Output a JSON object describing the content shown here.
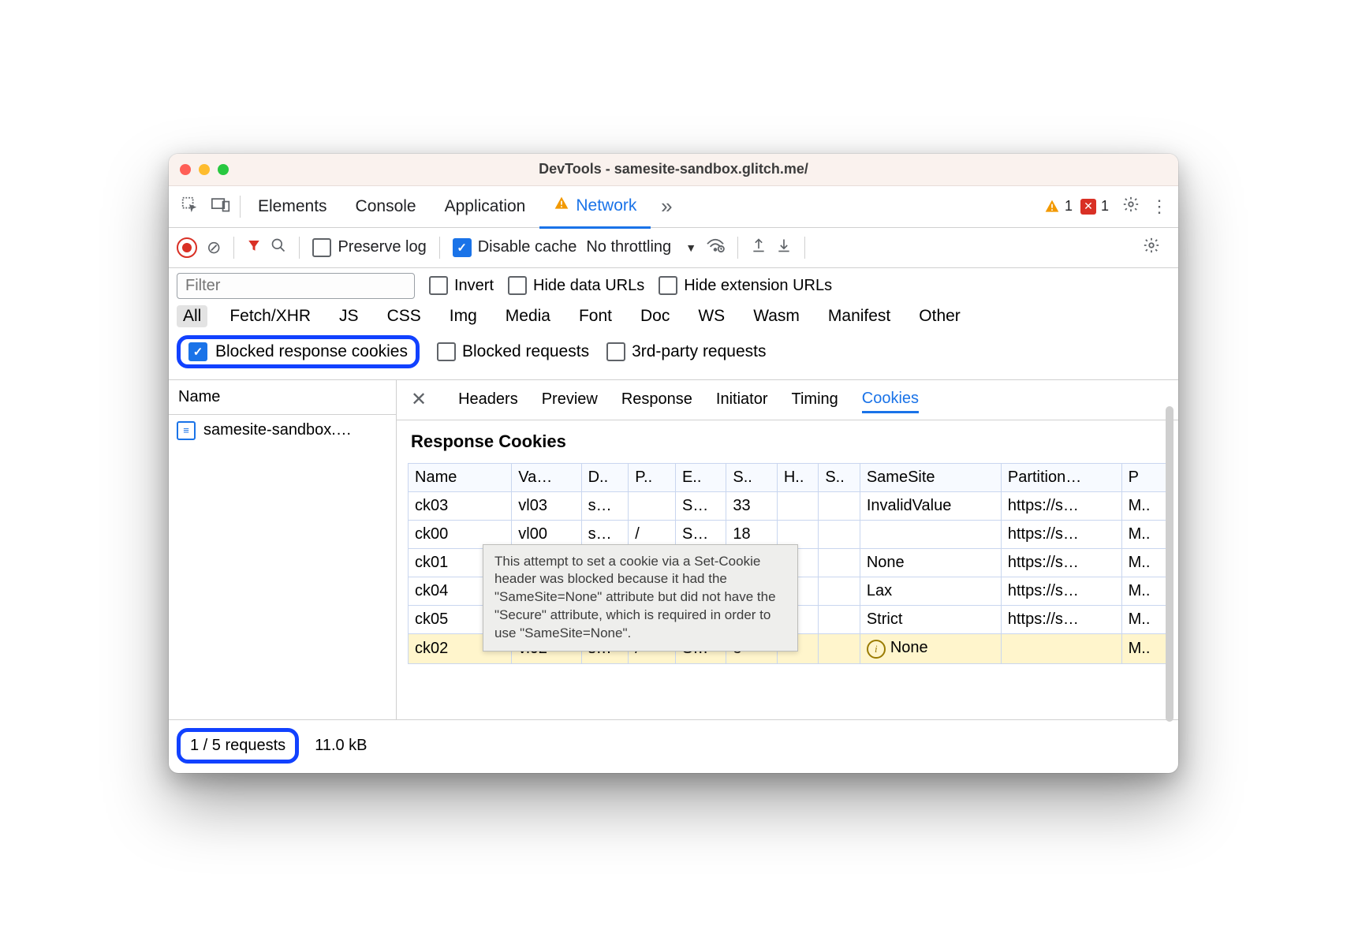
{
  "window": {
    "title": "DevTools - samesite-sandbox.glitch.me/"
  },
  "top_tabs": {
    "items": [
      "Elements",
      "Console",
      "Application",
      "Network"
    ],
    "active": "Network",
    "warning_count": "1",
    "error_count": "1"
  },
  "toolbar": {
    "preserve_log": {
      "label": "Preserve log",
      "checked": false
    },
    "disable_cache": {
      "label": "Disable cache",
      "checked": true
    },
    "throttling": "No throttling"
  },
  "filter": {
    "placeholder": "Filter",
    "invert": {
      "label": "Invert",
      "checked": false
    },
    "hide_data_urls": {
      "label": "Hide data URLs",
      "checked": false
    },
    "hide_ext_urls": {
      "label": "Hide extension URLs",
      "checked": false
    }
  },
  "type_filters": {
    "items": [
      "All",
      "Fetch/XHR",
      "JS",
      "CSS",
      "Img",
      "Media",
      "Font",
      "Doc",
      "WS",
      "Wasm",
      "Manifest",
      "Other"
    ],
    "active": "All"
  },
  "status_filters": {
    "blocked_cookies": {
      "label": "Blocked response cookies",
      "checked": true
    },
    "blocked_requests": {
      "label": "Blocked requests",
      "checked": false
    },
    "third_party": {
      "label": "3rd-party requests",
      "checked": false
    }
  },
  "requests": {
    "header": "Name",
    "items": [
      {
        "name": "samesite-sandbox.…"
      }
    ]
  },
  "detail_tabs": {
    "items": [
      "Headers",
      "Preview",
      "Response",
      "Initiator",
      "Timing",
      "Cookies"
    ],
    "active": "Cookies"
  },
  "cookies_section": {
    "title": "Response Cookies",
    "columns": [
      "Name",
      "Va…",
      "D..",
      "P..",
      "E..",
      "S..",
      "H..",
      "S..",
      "SameSite",
      "Partition…",
      "P"
    ],
    "rows": [
      {
        "cells": [
          "ck03",
          "vl03",
          "s…",
          "",
          "S…",
          "33",
          "",
          "",
          "InvalidValue",
          "https://s…",
          "M.."
        ]
      },
      {
        "cells": [
          "ck00",
          "vl00",
          "s…",
          "/",
          "S…",
          "18",
          "",
          "",
          "",
          "https://s…",
          "M.."
        ]
      },
      {
        "cells": [
          "ck01",
          "",
          "",
          "",
          "",
          "",
          "",
          "",
          "None",
          "https://s…",
          "M.."
        ]
      },
      {
        "cells": [
          "ck04",
          "",
          "",
          "",
          "",
          "",
          "",
          "",
          "Lax",
          "https://s…",
          "M.."
        ]
      },
      {
        "cells": [
          "ck05",
          "",
          "",
          "",
          "",
          "",
          "",
          "",
          "Strict",
          "https://s…",
          "M.."
        ]
      },
      {
        "cells": [
          "ck02",
          "vl02",
          "s…",
          "/",
          "S…",
          "8",
          "",
          "",
          "None",
          "",
          "M.."
        ],
        "highlighted": true,
        "info_in_samesite": true
      }
    ]
  },
  "tooltip": {
    "text": "This attempt to set a cookie via a Set-Cookie header was blocked because it had the \"SameSite=None\" attribute but did not have the \"Secure\" attribute, which is required in order to use \"SameSite=None\"."
  },
  "statusbar": {
    "requests": "1 / 5 requests",
    "transfer": "11.0 kB"
  }
}
